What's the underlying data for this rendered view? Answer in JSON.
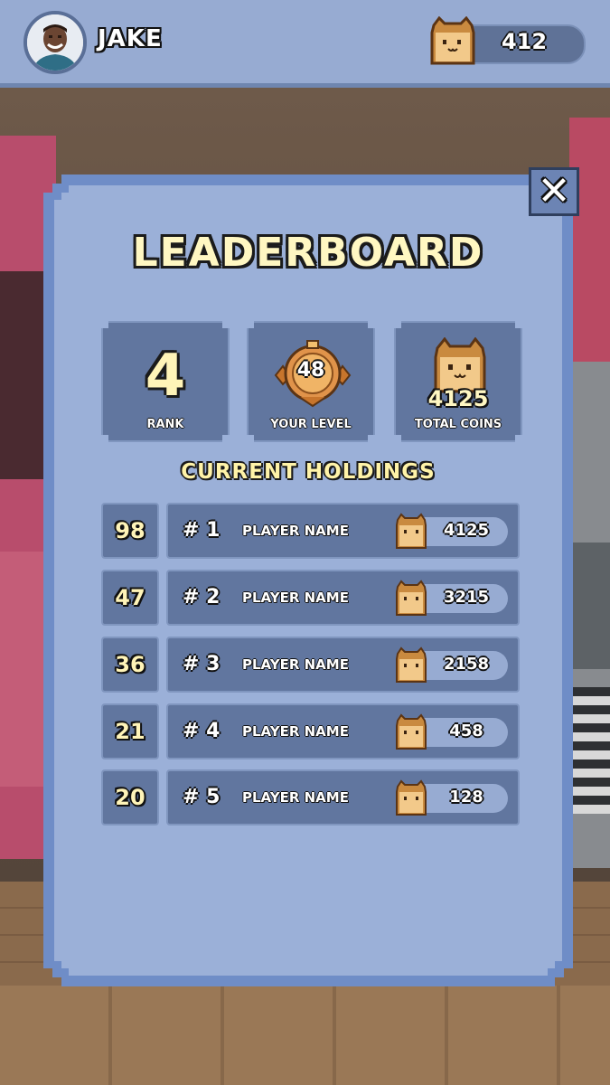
{
  "header": {
    "player_name": "JAKE",
    "coin_balance": "412"
  },
  "leaderboard": {
    "title": "LEADERBOARD",
    "stats": {
      "rank_value": "4",
      "rank_label": "RANK",
      "level_value": "48",
      "level_label": "YOUR LEVEL",
      "coins_value": "4125",
      "coins_label": "TOTAL COINS"
    },
    "holdings_title": "CURRENT HOLDINGS",
    "rows": [
      {
        "level": "98",
        "rank": "# 1",
        "name": "PLAYER NAME",
        "coins": "4125"
      },
      {
        "level": "47",
        "rank": "# 2",
        "name": "PLAYER NAME",
        "coins": "3215"
      },
      {
        "level": "36",
        "rank": "# 3",
        "name": "PLAYER NAME",
        "coins": "2158"
      },
      {
        "level": "21",
        "rank": "# 4",
        "name": "PLAYER NAME",
        "coins": "458"
      },
      {
        "level": "20",
        "rank": "# 5",
        "name": "PLAYER NAME",
        "coins": "128"
      }
    ]
  },
  "icons": {
    "close": "close-icon",
    "coin": "bread-coin-icon",
    "level": "level-medal-icon",
    "avatar": "player-avatar"
  },
  "colors": {
    "panel": "#9fb3da",
    "panel_border": "#6f8dc7",
    "tile": "#61769f",
    "title_text": "#fff7c2"
  }
}
